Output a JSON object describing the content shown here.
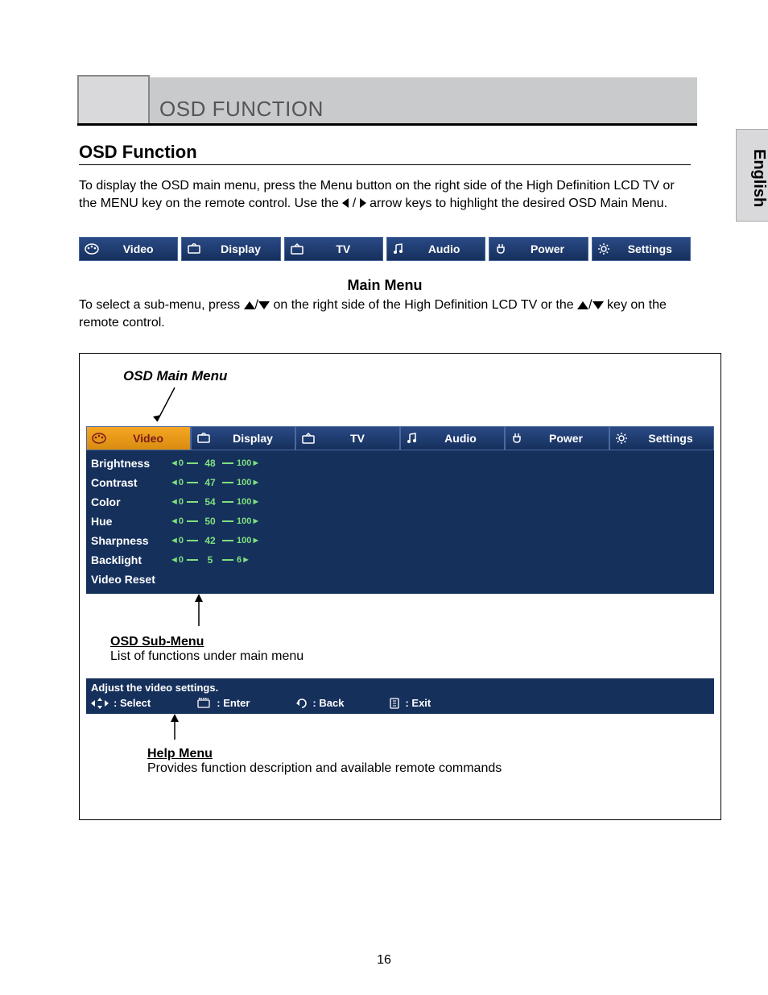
{
  "header": {
    "title": "OSD FUNCTION"
  },
  "side_tab": "English",
  "section": {
    "title": "OSD Function",
    "intro_a": "To display the OSD main menu, press the Menu button on the right side of the High Definition LCD TV or the MENU key on the remote control. Use the ",
    "intro_b": " / ",
    "intro_c": " arrow keys to highlight the desired OSD Main Menu."
  },
  "tabs": [
    {
      "label": "Video",
      "icon": "palette"
    },
    {
      "label": "Display",
      "icon": "display"
    },
    {
      "label": "TV",
      "icon": "tv"
    },
    {
      "label": "Audio",
      "icon": "note"
    },
    {
      "label": "Power",
      "icon": "plug"
    },
    {
      "label": "Settings",
      "icon": "gear"
    }
  ],
  "main_menu": {
    "heading": "Main Menu",
    "text_a": "To select a sub-menu, press ",
    "text_b": " on the right side of the High Definition LCD TV or the ",
    "text_c": " key on the remote control."
  },
  "osd": {
    "title": "OSD Main Menu",
    "rows": [
      {
        "label": "Brightness",
        "value": 48
      },
      {
        "label": "Contrast",
        "value": 47
      },
      {
        "label": "Color",
        "value": 54
      },
      {
        "label": "Hue",
        "value": 50
      },
      {
        "label": "Sharpness",
        "value": 42
      },
      {
        "label": "Backlight",
        "value": 5
      }
    ],
    "reset": "Video Reset"
  },
  "sub": {
    "title": "OSD Sub-Menu",
    "desc": "List of functions under main menu"
  },
  "helpbar": {
    "desc": "Adjust the video settings.",
    "select": ": Select",
    "enter": ": Enter",
    "back": ": Back",
    "exit": ": Exit"
  },
  "help": {
    "title": "Help Menu",
    "desc": "Provides function description and available remote commands"
  },
  "page": "16"
}
